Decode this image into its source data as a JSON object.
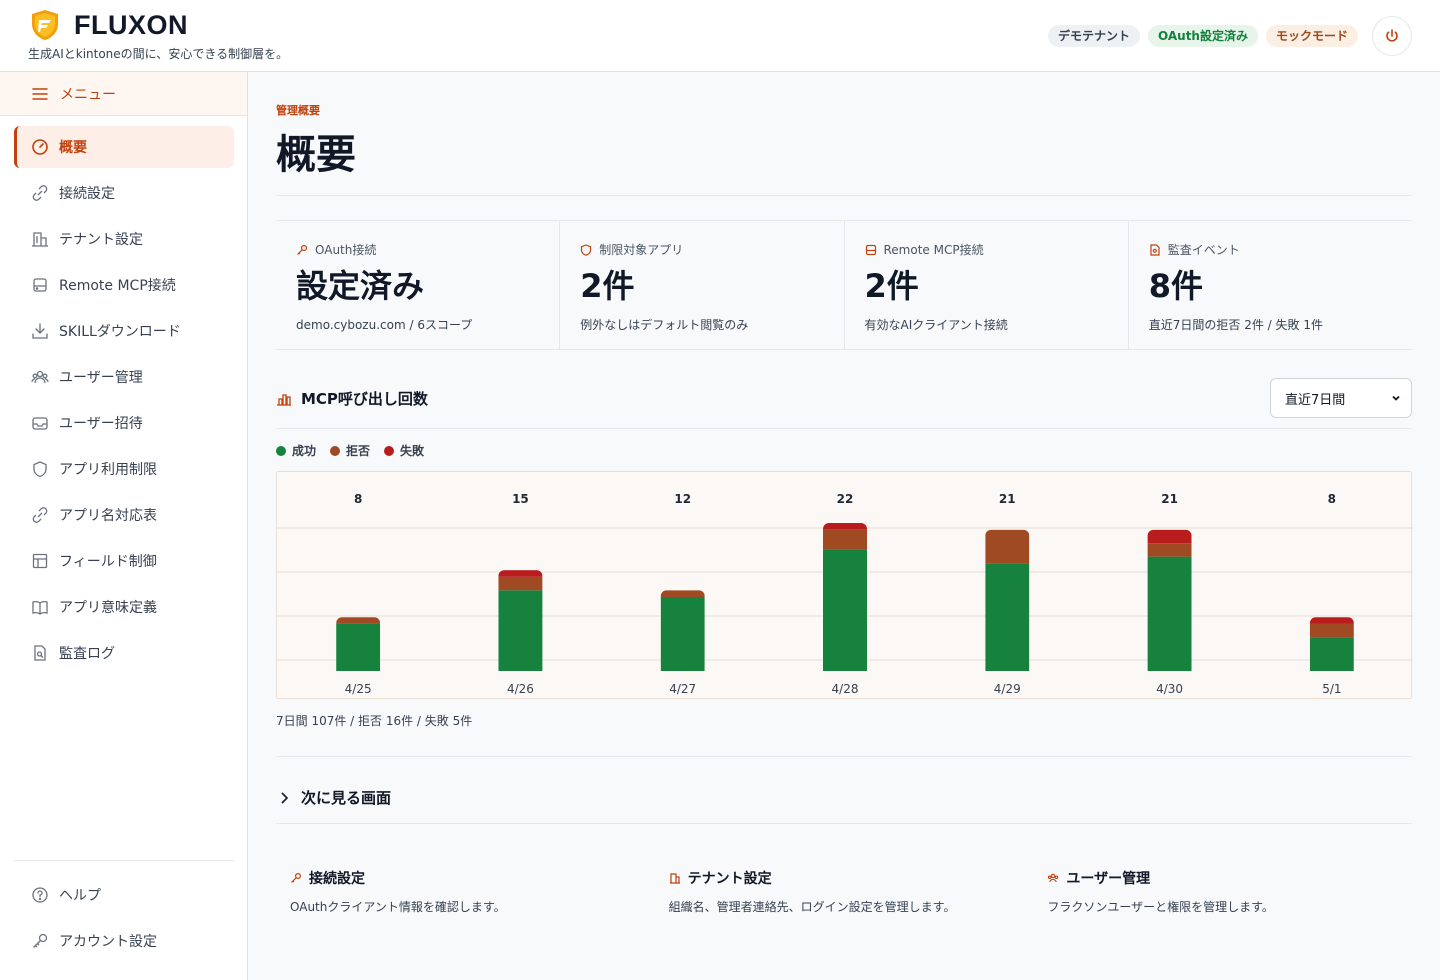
{
  "brand": {
    "name": "FLUXON",
    "tagline": "生成AIとkintoneの間に、安心できる制御層を。"
  },
  "header": {
    "badges": [
      "デモテナント",
      "OAuth設定済み",
      "モックモード"
    ]
  },
  "sidebar": {
    "menu_label": "メニュー",
    "items": [
      {
        "label": "概要",
        "icon": "dashboard-icon",
        "active": true
      },
      {
        "label": "接続設定",
        "icon": "link-icon"
      },
      {
        "label": "テナント設定",
        "icon": "building-icon"
      },
      {
        "label": "Remote MCP接続",
        "icon": "server-icon"
      },
      {
        "label": "SKILLダウンロード",
        "icon": "download-icon"
      },
      {
        "label": "ユーザー管理",
        "icon": "users-icon"
      },
      {
        "label": "ユーザー招待",
        "icon": "inbox-icon"
      },
      {
        "label": "アプリ利用制限",
        "icon": "shield-icon"
      },
      {
        "label": "アプリ名対応表",
        "icon": "link-icon"
      },
      {
        "label": "フィールド制御",
        "icon": "table-icon"
      },
      {
        "label": "アプリ意味定義",
        "icon": "book-icon"
      },
      {
        "label": "監査ログ",
        "icon": "audit-icon"
      }
    ],
    "bottom_items": [
      {
        "label": "ヘルプ",
        "icon": "help-icon"
      },
      {
        "label": "アカウント設定",
        "icon": "key-icon"
      }
    ]
  },
  "main": {
    "breadcrumb": "管理概要",
    "title": "概要",
    "stats": [
      {
        "label": "OAuth接続",
        "icon": "key-icon",
        "value": "設定済み",
        "sub": "demo.cybozu.com / 6スコープ"
      },
      {
        "label": "制限対象アプリ",
        "icon": "shield-icon",
        "value": "2件",
        "sub": "例外なしはデフォルト閲覧のみ"
      },
      {
        "label": "Remote MCP接続",
        "icon": "server-icon",
        "value": "2件",
        "sub": "有効なAIクライアント接続"
      },
      {
        "label": "監査イベント",
        "icon": "audit-icon",
        "value": "8件",
        "sub": "直近7日間の拒否 2件 / 失敗 1件"
      }
    ],
    "chart_section_title": "MCP呼び出し回数",
    "period_select": "直近7日間",
    "chart_summary": "7日間 107件 / 拒否 16件 / 失敗 5件",
    "next_section_title": "次に見る画面",
    "cards": [
      {
        "title": "接続設定",
        "icon": "key-icon",
        "desc": "OAuthクライアント情報を確認します。"
      },
      {
        "title": "テナント設定",
        "icon": "building-icon",
        "desc": "組織名、管理者連絡先、ログイン設定を管理します。"
      },
      {
        "title": "ユーザー管理",
        "icon": "users-icon",
        "desc": "フラクソンユーザーと権限を管理します。"
      }
    ]
  },
  "colors": {
    "success": "#17813e",
    "rejected": "#a04a24",
    "failed": "#b91c1c",
    "accent": "#c2410c"
  },
  "chart_data": {
    "type": "bar",
    "stacked": true,
    "categories": [
      "4/25",
      "4/26",
      "4/27",
      "4/28",
      "4/29",
      "4/30",
      "5/1"
    ],
    "totals": [
      8,
      15,
      12,
      22,
      21,
      21,
      8
    ],
    "series": [
      {
        "name": "成功",
        "values": [
          7,
          12,
          11,
          18,
          16,
          17,
          5
        ]
      },
      {
        "name": "拒否",
        "values": [
          1,
          2,
          1,
          3,
          5,
          2,
          2
        ]
      },
      {
        "name": "失敗",
        "values": [
          0,
          1,
          0,
          1,
          0,
          2,
          1
        ]
      }
    ],
    "ylim": [
      0,
      22
    ]
  }
}
